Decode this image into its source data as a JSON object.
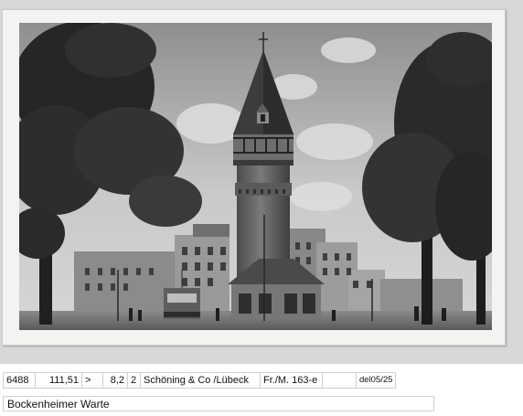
{
  "photo": {
    "subject": "Bockenheimer Warte"
  },
  "meta": {
    "number": "6488",
    "value": "111,51",
    "flag": ">",
    "grade": "8,2",
    "count": "2",
    "publisher": "Schöning & Co /Lübeck",
    "reference": "Fr./M. 163-e",
    "blank": "",
    "date_code": "del05/25"
  },
  "caption": {
    "title": "Bockenheimer Warte"
  },
  "colors": {
    "background": "#e4e4e4",
    "card": "#f3f3f1",
    "strip": "#ffffff",
    "border": "#cfcfcf"
  }
}
